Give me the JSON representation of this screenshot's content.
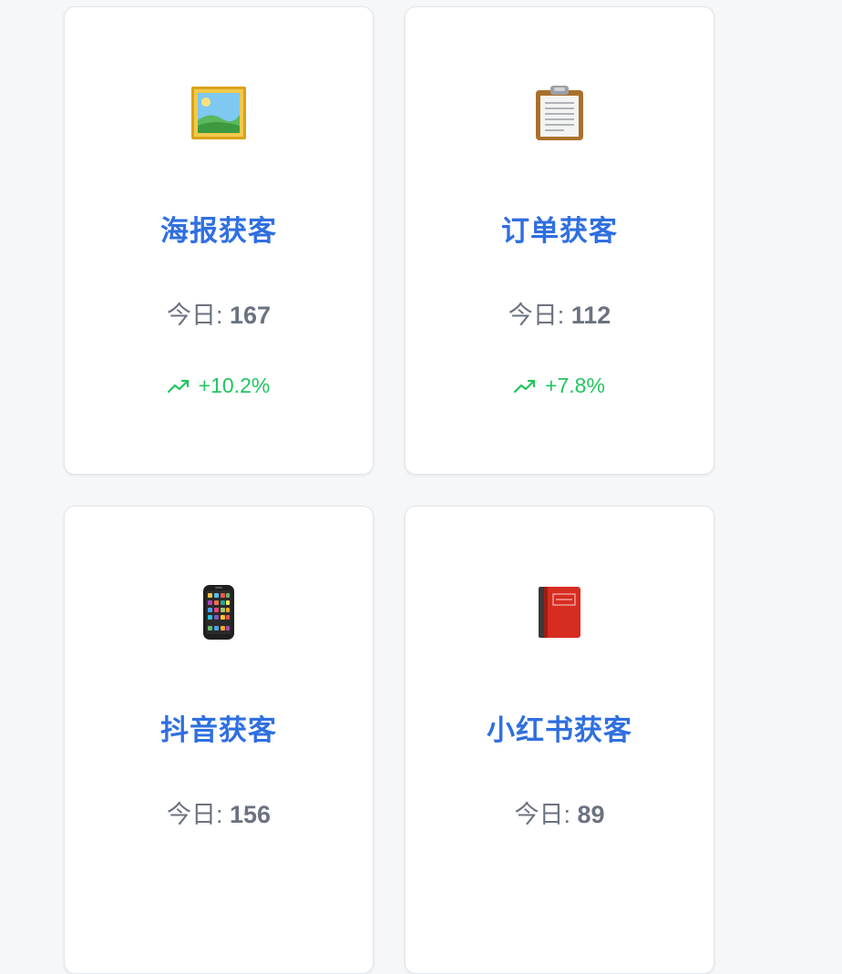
{
  "cards": [
    {
      "title": "海报获客",
      "today_label": "今日:",
      "today_value": "167",
      "trend": "+10.2%",
      "icon": "framed-picture-icon"
    },
    {
      "title": "订单获客",
      "today_label": "今日:",
      "today_value": "112",
      "trend": "+7.8%",
      "icon": "clipboard-icon"
    },
    {
      "title": "抖音获客",
      "today_label": "今日:",
      "today_value": "156",
      "trend": "",
      "icon": "mobile-phone-icon"
    },
    {
      "title": "小红书获客",
      "today_label": "今日:",
      "today_value": "89",
      "trend": "",
      "icon": "red-book-icon"
    }
  ],
  "colors": {
    "title": "#2f6fe0",
    "muted": "#6b7280",
    "positive": "#22c55e",
    "background": "#f6f7f9"
  }
}
